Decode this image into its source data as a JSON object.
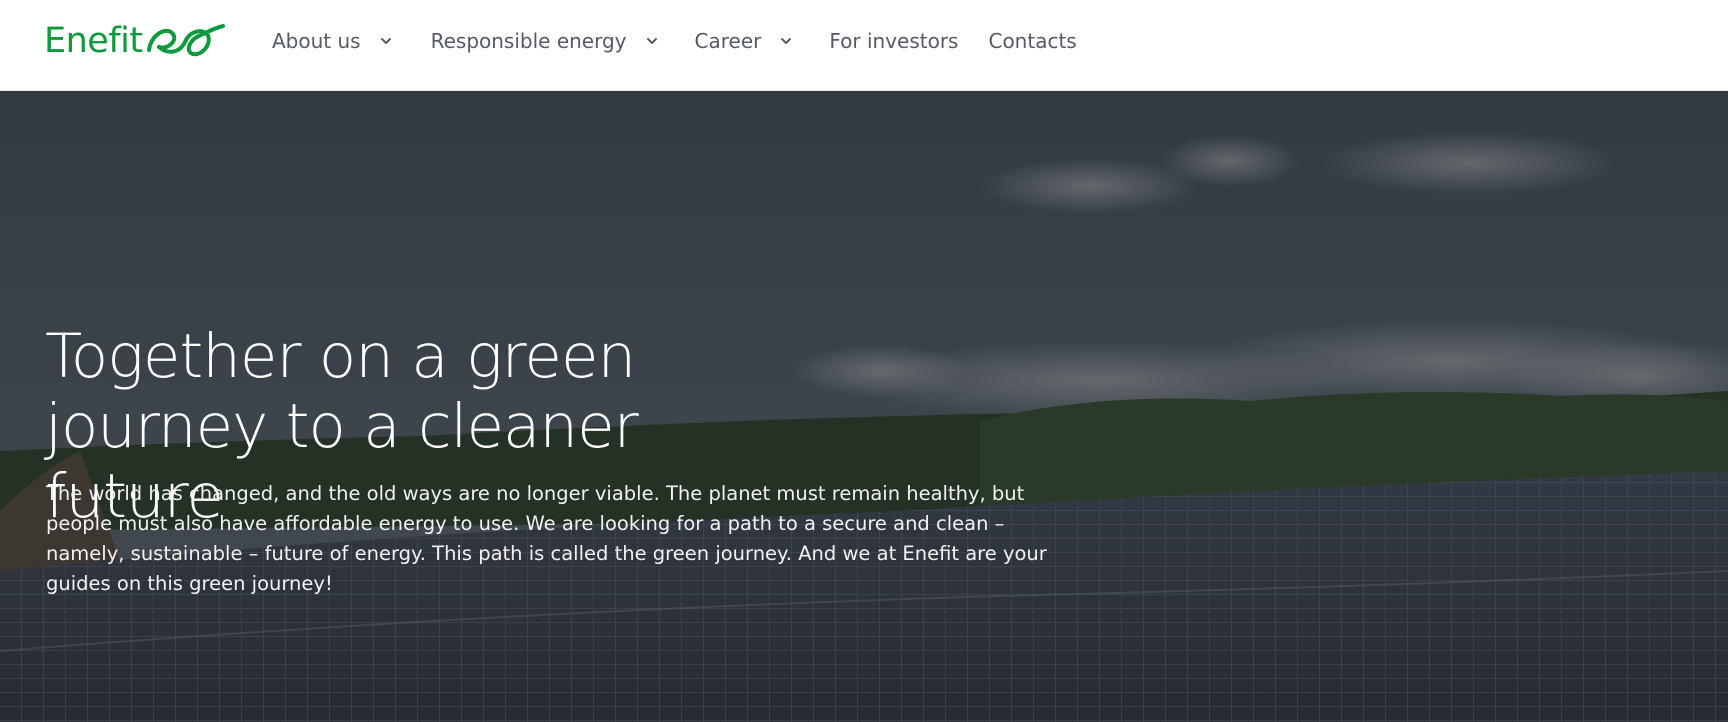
{
  "brand": {
    "name": "Enefit",
    "color": "#0c9b3c"
  },
  "nav": {
    "items": [
      {
        "label": "About us",
        "has_dropdown": true
      },
      {
        "label": "Responsible energy",
        "has_dropdown": true
      },
      {
        "label": "Career",
        "has_dropdown": true
      },
      {
        "label": "For investors",
        "has_dropdown": false
      },
      {
        "label": "Contacts",
        "has_dropdown": false
      }
    ],
    "text_color": "#545b66",
    "dropdown_icon": "chevron-down-icon"
  },
  "hero": {
    "title_line1": "Together on a green",
    "title_line2": "journey to a cleaner future",
    "text": "The world has changed, and the old ways are no longer viable. The planet must remain healthy, but people must also have affordable energy to use. We are looking for a path to a secure and clean – namely, sustainable – future of energy. This path is called the green journey. And we at Enefit are your guides on this green journey!",
    "background": "solar-farm-photo"
  }
}
